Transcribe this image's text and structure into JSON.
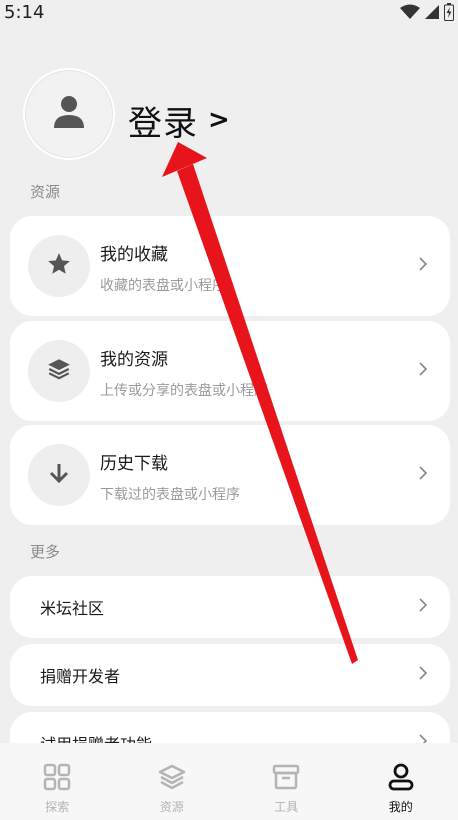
{
  "status_bar": {
    "time": "5:14",
    "icons": [
      "wifi-icon",
      "signal-icon",
      "battery-icon"
    ]
  },
  "profile": {
    "login_label": "登录",
    "login_arrow": ">",
    "avatar_icon": "person-icon"
  },
  "sections": {
    "resources_label": "资源",
    "more_label": "更多"
  },
  "resource_cards": [
    {
      "icon": "star-icon",
      "title": "我的收藏",
      "subtitle": "收藏的表盘或小程序"
    },
    {
      "icon": "layers-icon",
      "title": "我的资源",
      "subtitle": "上传或分享的表盘或小程序"
    },
    {
      "icon": "download-icon",
      "title": "历史下载",
      "subtitle": "下载过的表盘或小程序"
    }
  ],
  "more_items": [
    {
      "label": "米坛社区"
    },
    {
      "label": "捐赠开发者"
    },
    {
      "label": "试用捐赠者功能"
    }
  ],
  "bottom_nav": [
    {
      "label": "探索",
      "icon": "grid-icon",
      "active": false
    },
    {
      "label": "资源",
      "icon": "layers-icon",
      "active": false
    },
    {
      "label": "工具",
      "icon": "archive-icon",
      "active": false
    },
    {
      "label": "我的",
      "icon": "person-icon",
      "active": true
    }
  ],
  "colors": {
    "background": "#efefef",
    "card": "#ffffff",
    "icon_circle": "#eeeeee",
    "icon": "#555555",
    "arrow_annotation": "#e8141c",
    "nav_active": "#111111",
    "nav_inactive": "#b4b4b4"
  }
}
